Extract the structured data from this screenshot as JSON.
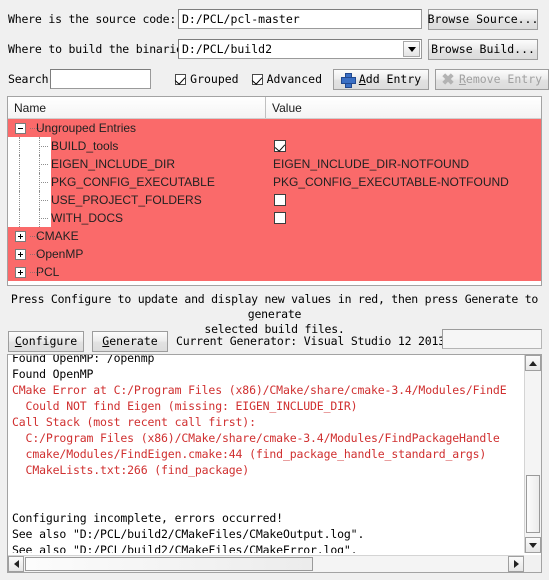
{
  "colors": {
    "row_red": "#fa6a6a",
    "error_text": "#d03030",
    "accent_blue": "#3a6fc4"
  },
  "source_row": {
    "label": "Where is the source code:",
    "value": "D:/PCL/pcl-master",
    "placeholder": "",
    "browse_label": "Browse Source..."
  },
  "build_row": {
    "label": "Where to build the binaries:",
    "value": "D:/PCL/build2",
    "placeholder": "",
    "browse_label": "Browse Build..."
  },
  "search_row": {
    "label": "Search:",
    "value": "",
    "placeholder": "",
    "grouped_label": "Grouped",
    "grouped_checked": true,
    "advanced_label": "Advanced",
    "advanced_checked": true,
    "add_entry_label": "Add Entry",
    "remove_entry_label": "Remove Entry",
    "remove_entry_disabled": true
  },
  "table": {
    "columns": [
      "Name",
      "Value"
    ],
    "rows": [
      {
        "kind": "group",
        "expander": "minus",
        "name": "Ungrouped Entries",
        "value": "",
        "value_type": "none"
      },
      {
        "kind": "child",
        "expander": "none",
        "name": "BUILD_tools",
        "value": "",
        "value_type": "checkbox",
        "checked": true
      },
      {
        "kind": "child",
        "expander": "none",
        "name": "EIGEN_INCLUDE_DIR",
        "value": "EIGEN_INCLUDE_DIR-NOTFOUND",
        "value_type": "text"
      },
      {
        "kind": "child",
        "expander": "none",
        "name": "PKG_CONFIG_EXECUTABLE",
        "value": "PKG_CONFIG_EXECUTABLE-NOTFOUND",
        "value_type": "text"
      },
      {
        "kind": "child",
        "expander": "none",
        "name": "USE_PROJECT_FOLDERS",
        "value": "",
        "value_type": "checkbox",
        "checked": false
      },
      {
        "kind": "child",
        "expander": "none",
        "name": "WITH_DOCS",
        "value": "",
        "value_type": "checkbox",
        "checked": false
      },
      {
        "kind": "group",
        "expander": "plus",
        "name": "CMAKE",
        "value": "",
        "value_type": "none"
      },
      {
        "kind": "group",
        "expander": "plus",
        "name": "OpenMP",
        "value": "",
        "value_type": "none"
      },
      {
        "kind": "group",
        "expander": "plus",
        "name": "PCL",
        "value": "",
        "value_type": "none"
      }
    ]
  },
  "hint": {
    "line1": "Press Configure to update and display new values in red, then press Generate to generate",
    "line2": "selected build files."
  },
  "actions": {
    "configure_label": "Configure",
    "generate_label": "Generate",
    "generator_text": "Current Generator: Visual Studio 12 2013",
    "progress_value": ""
  },
  "log": {
    "lines": [
      {
        "text": "Found OpenMP: /openmp",
        "error": false,
        "clipped_top": true
      },
      {
        "text": "Found OpenMP",
        "error": false
      },
      {
        "text": "CMake Error at C:/Program Files (x86)/CMake/share/cmake-3.4/Modules/FindE",
        "error": true
      },
      {
        "text": "  Could NOT find Eigen (missing: EIGEN_INCLUDE_DIR)",
        "error": true
      },
      {
        "text": "Call Stack (most recent call first):",
        "error": true
      },
      {
        "text": "  C:/Program Files (x86)/CMake/share/cmake-3.4/Modules/FindPackageHandle",
        "error": true
      },
      {
        "text": "  cmake/Modules/FindEigen.cmake:44 (find_package_handle_standard_args)",
        "error": true
      },
      {
        "text": "  CMakeLists.txt:266 (find_package)",
        "error": true
      },
      {
        "text": "",
        "error": false
      },
      {
        "text": "",
        "error": false
      },
      {
        "text": "Configuring incomplete, errors occurred!",
        "error": false
      },
      {
        "text": "See also \"D:/PCL/build2/CMakeFiles/CMakeOutput.log\".",
        "error": false
      },
      {
        "text": "See also \"D:/PCL/build2/CMakeFiles/CMakeError.log\".",
        "error": false
      }
    ]
  }
}
